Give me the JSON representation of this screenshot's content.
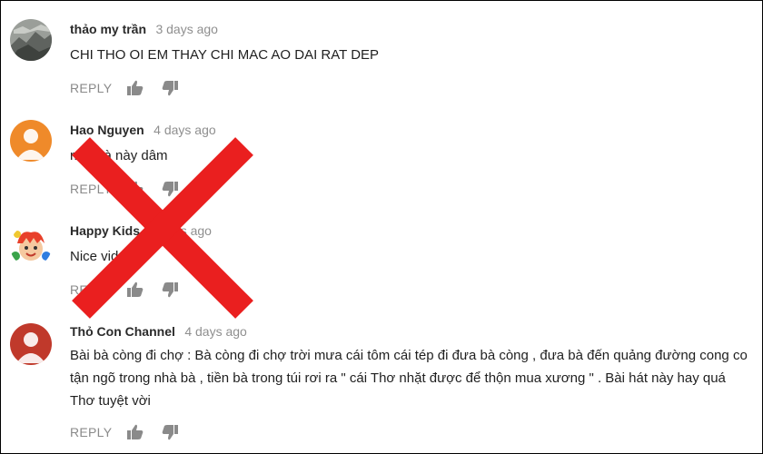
{
  "comments": [
    {
      "author": "thảo my trần",
      "time": "3 days ago",
      "lines": [
        "CHI THO OI EM THAY CHI MAC AO DAI RAT DEP"
      ],
      "reply_label": "REPLY",
      "avatar": {
        "kind": "photo",
        "color": "#8a8f8a"
      }
    },
    {
      "author": "Hao Nguyen",
      "time": "4 days ago",
      "lines": [
        "mặt bà này dâm"
      ],
      "reply_label": "REPLY",
      "avatar": {
        "kind": "default",
        "color": "#ef8a2a"
      }
    },
    {
      "author": "Happy Kids",
      "time": "4 days ago",
      "lines": [
        "Nice video"
      ],
      "reply_label": "REPLY",
      "avatar": {
        "kind": "cartoon",
        "color": "#f0c830"
      }
    },
    {
      "author": "Thỏ Con Channel",
      "time": "4 days ago",
      "lines": [
        "Bài bà còng đi chợ : Bà còng đi chợ trời mưa cái tôm cái tép đi đưa bà còng , đưa bà đến quảng đường cong co",
        "tận ngõ trong nhà bà , tiền bà trong túi rơi ra \" cái Thơ nhặt được để thộn mua xương \" . Bài hát này hay quá",
        "Thơ tuyệt vời"
      ],
      "reply_label": "REPLY",
      "avatar": {
        "kind": "default",
        "color": "#c0392b"
      }
    }
  ],
  "overlay": {
    "icon": "red-x-mark-icon",
    "color": "#ea1f1f"
  },
  "icons": {
    "like": "thumbs-up-icon",
    "dislike": "thumbs-down-icon"
  }
}
